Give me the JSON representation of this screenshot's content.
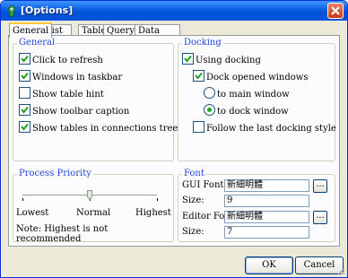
{
  "window": {
    "title": "[Options]"
  },
  "tabs": [
    {
      "label": "General",
      "active": true
    },
    {
      "label": "List View",
      "active": false
    },
    {
      "label": "Table",
      "active": false
    },
    {
      "label": "Query",
      "active": false
    },
    {
      "label": "Data Transfer",
      "active": false
    }
  ],
  "general": {
    "title": "General",
    "items": [
      {
        "label": "Click to refresh",
        "checked": true
      },
      {
        "label": "Windows in taskbar",
        "checked": true
      },
      {
        "label": "Show table hint",
        "checked": false
      },
      {
        "label": "Show toolbar caption",
        "checked": true
      },
      {
        "label": "Show tables in connections tree",
        "checked": true
      }
    ]
  },
  "docking": {
    "title": "Docking",
    "use_docking": {
      "label": "Using docking",
      "checked": true
    },
    "dock_windows": {
      "label": "Dock opened windows",
      "checked": true
    },
    "to_main": {
      "label": "to main window",
      "selected": false
    },
    "to_dock": {
      "label": "to dock window",
      "selected": true
    },
    "follow_last": {
      "label": "Follow the last docking style",
      "checked": false
    }
  },
  "priority": {
    "title": "Process Priority",
    "low": "Lowest",
    "normal": "Normal",
    "high": "Highest",
    "note": "Note: Highest is not recommended",
    "level": 0.5
  },
  "font": {
    "title": "Font",
    "gui_label": "GUI Font:",
    "gui_value": "新細明體",
    "size_label": "Size:",
    "gui_size": "9",
    "editor_label": "Editor Font:",
    "editor_value": "新細明體",
    "editor_size": "7",
    "browse": "..."
  },
  "buttons": {
    "ok": "OK",
    "cancel": "Cancel"
  },
  "colors": {
    "titlebar": "#0a5fe0",
    "group_title": "#2248d8",
    "check": "#21a121"
  }
}
